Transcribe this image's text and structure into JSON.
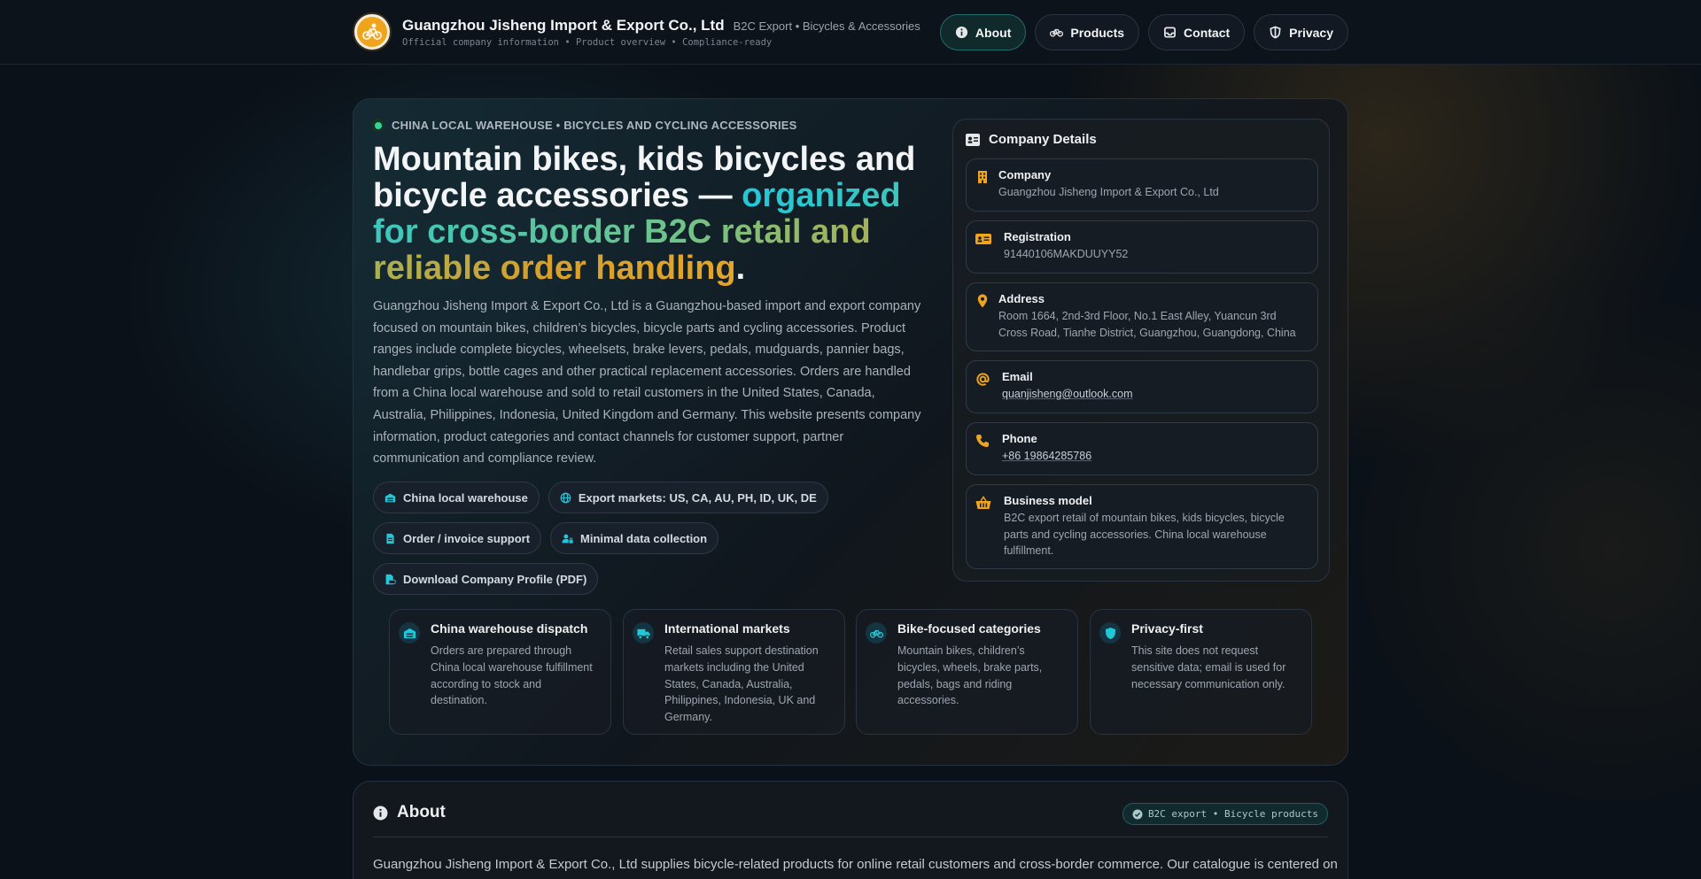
{
  "header": {
    "company_name": "Guangzhou Jisheng Import & Export Co., Ltd",
    "tagline": "B2C Export • Bicycles & Accessories",
    "subline": "Official company information • Product overview • Compliance-ready",
    "nav": [
      {
        "label": "About",
        "icon": "info-icon",
        "active": true
      },
      {
        "label": "Products",
        "icon": "bicycle-icon",
        "active": false
      },
      {
        "label": "Contact",
        "icon": "inbox-icon",
        "active": false
      },
      {
        "label": "Privacy",
        "icon": "shield-icon",
        "active": false
      }
    ]
  },
  "hero": {
    "eyebrow": "CHINA LOCAL WAREHOUSE • BICYCLES AND CYCLING ACCESSORIES",
    "headline_plain": "Mountain bikes, kids bicycles and bicycle accessories — ",
    "headline_highlight": "organized for cross-border B2C retail and reliable order handling",
    "headline_end": ".",
    "intro": "Guangzhou Jisheng Import & Export Co., Ltd is a Guangzhou-based import and export company focused on mountain bikes, children’s bicycles, bicycle parts and cycling accessories. Product ranges include complete bicycles, wheelsets, brake levers, pedals, mudguards, pannier bags, handlebar grips, bottle cages and other practical replacement accessories. Orders are handled from a China local warehouse and sold to retail customers in the United States, Canada, Australia, Philippines, Indonesia, United Kingdom and Germany. This website presents company information, product categories and contact channels for customer support, partner communication and compliance review.",
    "chips": [
      {
        "label": "China local warehouse",
        "icon": "warehouse-icon"
      },
      {
        "label": "Export markets: US, CA, AU, PH, ID, UK, DE",
        "icon": "globe-icon"
      },
      {
        "label": "Order / invoice support",
        "icon": "document-icon"
      },
      {
        "label": "Minimal data collection",
        "icon": "user-lock-icon"
      },
      {
        "label": "Download Company Profile (PDF)",
        "icon": "pdf-icon"
      }
    ]
  },
  "details": {
    "title": "Company Details",
    "items": [
      {
        "label": "Company",
        "value": "Guangzhou Jisheng Import & Export Co., Ltd",
        "icon": "building-icon"
      },
      {
        "label": "Registration",
        "value": "91440106MAKDUUYY52",
        "icon": "id-card-icon"
      },
      {
        "label": "Address",
        "value": "Room 1664, 2nd-3rd Floor, No.1 East Alley, Yuancun 3rd Cross Road, Tianhe District, Guangzhou, Guangdong, China",
        "icon": "location-pin-icon"
      },
      {
        "label": "Email",
        "value": "quanjisheng@outlook.com",
        "icon": "at-sign-icon"
      },
      {
        "label": "Phone",
        "value": "+86 19864285786",
        "icon": "phone-icon"
      },
      {
        "label": "Business model",
        "value": "B2C export retail of mountain bikes, kids bicycles, bicycle parts and cycling accessories. China local warehouse fulfillment.",
        "icon": "basket-icon"
      }
    ]
  },
  "features": [
    {
      "title": "China warehouse dispatch",
      "desc": "Orders are prepared through China local warehouse fulfillment according to stock and destination.",
      "icon": "warehouse-icon"
    },
    {
      "title": "International markets",
      "desc": "Retail sales support destination markets including the United States, Canada, Australia, Philippines, Indonesia, UK and Germany.",
      "icon": "truck-icon"
    },
    {
      "title": "Bike-focused categories",
      "desc": "Mountain bikes, children’s bicycles, wheels, brake parts, pedals, bags and riding accessories.",
      "icon": "bicycle-icon"
    },
    {
      "title": "Privacy-first",
      "desc": "This site does not request sensitive data; email is used for necessary communication only.",
      "icon": "shield-icon"
    }
  ],
  "about": {
    "title": "About",
    "badge": "B2C export • Bicycle products",
    "text": "Guangzhou Jisheng Import & Export Co., Ltd supplies bicycle-related products for online retail customers and cross-border commerce. Our catalogue is centered on"
  },
  "colors": {
    "accent_teal": "#22c7d8",
    "accent_gold": "#f0a41c",
    "status_green": "#34d399"
  }
}
